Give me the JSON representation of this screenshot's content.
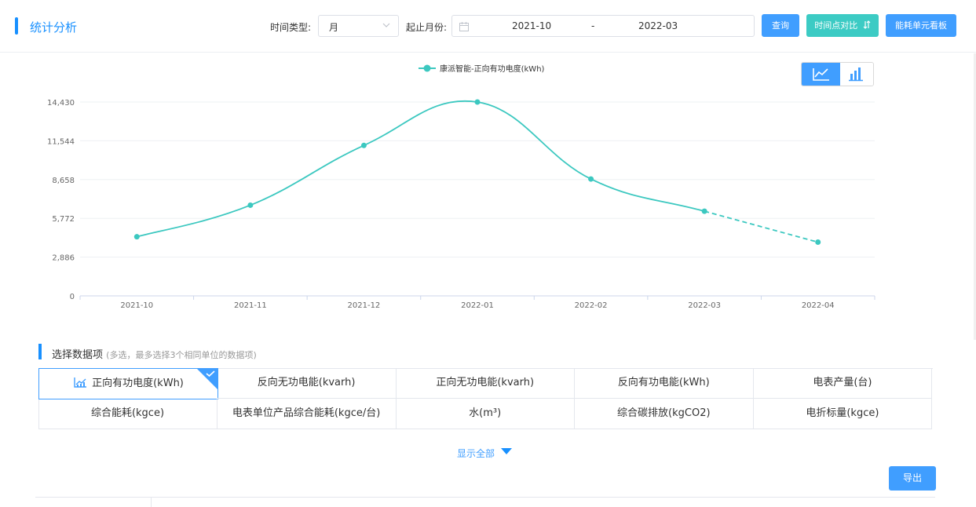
{
  "header": {
    "title": "统计分析",
    "time_type_label": "时间类型:",
    "time_type_value": "月",
    "month_range_label": "起止月份:",
    "date_start": "2021-10",
    "date_separator": "-",
    "date_end": "2022-03",
    "query_label": "查询",
    "compare_label": "时间点对比",
    "compare_icon": "sort-arrows-icon",
    "board_label": "能耗单元看板"
  },
  "chart_toggle": {
    "line_icon": "line-chart-icon",
    "bar_icon": "bar-chart-icon",
    "active": "line"
  },
  "chart_data": {
    "type": "line",
    "x": [
      "2021-10",
      "2021-11",
      "2021-12",
      "2022-01",
      "2022-02",
      "2022-03",
      "2022-04"
    ],
    "series": [
      {
        "name": "康派智能-正向有功电度(kWh)",
        "values": [
          4400,
          6750,
          11200,
          14430,
          8700,
          6300,
          4000
        ],
        "color": "#3cc8c0",
        "dashed_from_index": 5
      }
    ],
    "yticks": [
      "0",
      "2,886",
      "5,772",
      "8,658",
      "11,544",
      "14,430"
    ],
    "ylim": [
      0,
      14430
    ],
    "grid": true,
    "legend": "top-center"
  },
  "section": {
    "title": "选择数据项",
    "hint": "(多选，最多选择3个相同单位的数据项)"
  },
  "data_items": [
    {
      "label": "正向有功电度(kWh)",
      "selected": true
    },
    {
      "label": "反向无功电能(kvarh)",
      "selected": false
    },
    {
      "label": "正向无功电能(kvarh)",
      "selected": false
    },
    {
      "label": "反向有功电能(kWh)",
      "selected": false
    },
    {
      "label": "电表产量(台)",
      "selected": false
    },
    {
      "label": "综合能耗(kgce)",
      "selected": false
    },
    {
      "label": "电表单位产品综合能耗(kgce/台)",
      "selected": false
    },
    {
      "label": "水(m³)",
      "selected": false
    },
    {
      "label": "综合碳排放(kgCO2)",
      "selected": false
    },
    {
      "label": "电折标量(kgce)",
      "selected": false
    }
  ],
  "show_all_label": "显示全部",
  "export_label": "导出",
  "colors": {
    "primary": "#409eff",
    "teal": "#3ccbc4",
    "series": "#3cc8c0"
  }
}
